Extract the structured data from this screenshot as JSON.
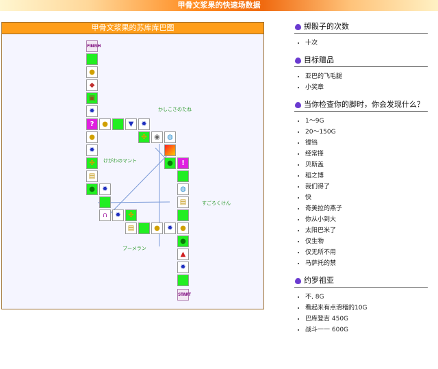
{
  "banner": {
    "title": "甲骨文浆果的快速场数据"
  },
  "board": {
    "header": "甲骨文浆果的苏库库巴图",
    "finish_label": "FINISH",
    "start_label": "START",
    "labels": {
      "kashikosa": "かしこさのたね",
      "kegawa": "けがわのマント",
      "sugoroku": "すごろくけん",
      "boomerang": "ブーメラン"
    }
  },
  "sections": {
    "dice": {
      "title": "掷骰子的次数",
      "items": [
        "十次"
      ]
    },
    "prizes": {
      "title": "目标赠品",
      "items": [
        "亚巴的飞毛腿",
        "小奖章"
      ]
    },
    "feet": {
      "title": "当你检查你的脚时，你会发现什么？",
      "items": [
        "1～9G",
        "20～150G",
        "镗铛",
        "经常搽",
        "贝斯盖",
        "稻之博",
        "我们得了",
        "快",
        "奇美拉的燕子",
        "你从小到大",
        "太阳巴米了",
        "仅生物",
        "仅无所不用",
        "马萨托的禁"
      ]
    },
    "joroya": {
      "title": "约罗祖亚",
      "items": [
        "不, 8G",
        "看起来有点滑稽的10G",
        "巴库登吉 450G",
        "战斗一一 600G"
      ]
    }
  },
  "colors": {
    "accent": "#ff9e1a",
    "tile_green": "#22ee22",
    "icon_drop": "#6a3ad0"
  }
}
